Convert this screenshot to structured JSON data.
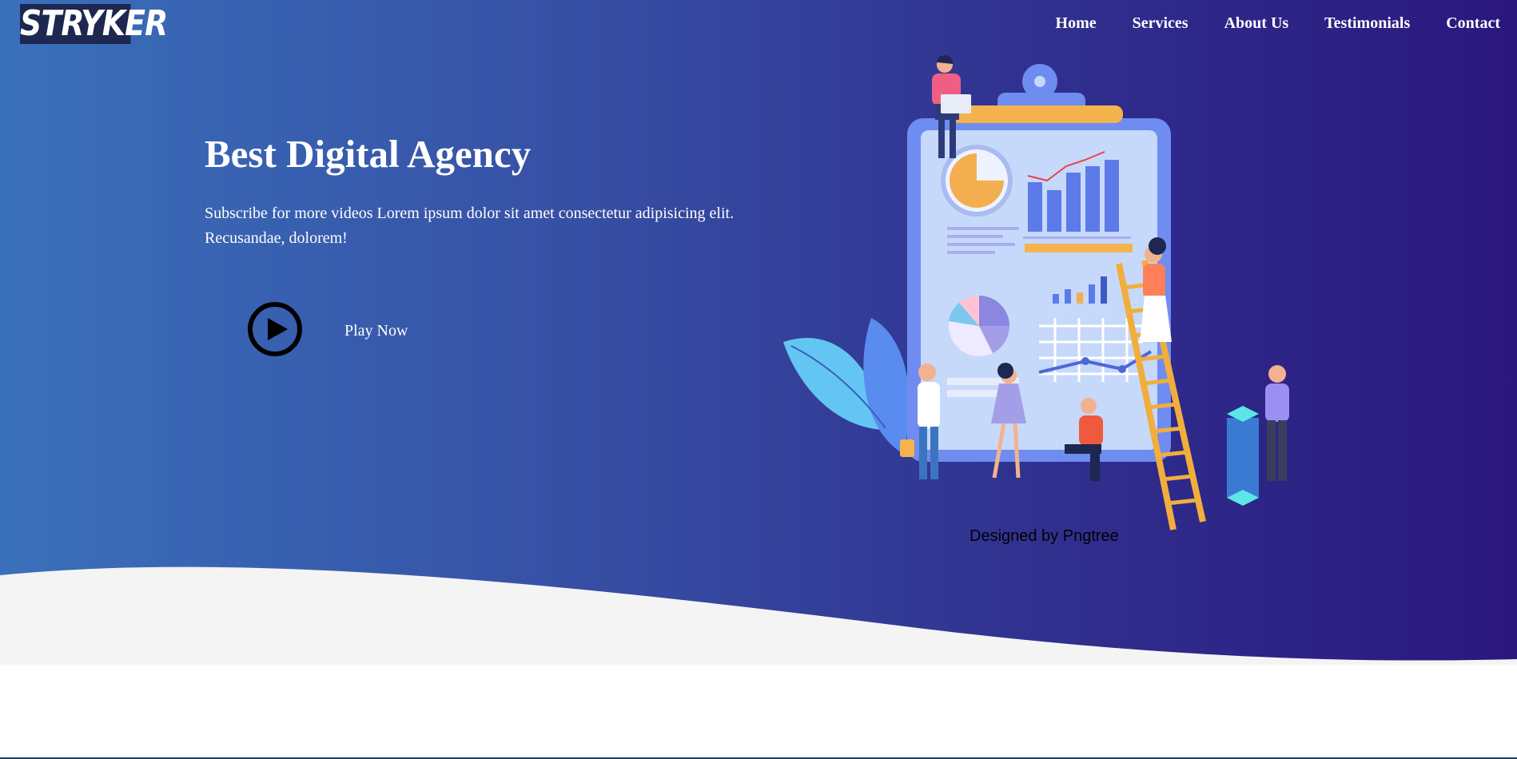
{
  "brand": {
    "logo_text": "STRYKER"
  },
  "nav": {
    "items": [
      "Home",
      "Services",
      "About Us",
      "Testimonials",
      "Contact"
    ]
  },
  "hero": {
    "title": "Best Digital Agency",
    "subtitle": "Subscribe for more videos Lorem ipsum dolor sit amet consectetur adipisicing elit. Recusandae, dolorem!",
    "play_label": "Play Now",
    "credit": "Designed by Pngtree",
    "illustration_icon": "digital-agency-illustration"
  },
  "colors": {
    "gradient_start": "#3a70bb",
    "gradient_end": "#2a177d",
    "wave": "#f4f4f5",
    "logo_bg": "#1d2750",
    "accent_orange": "#f2ae4f",
    "accent_blue": "#5c7be8"
  }
}
